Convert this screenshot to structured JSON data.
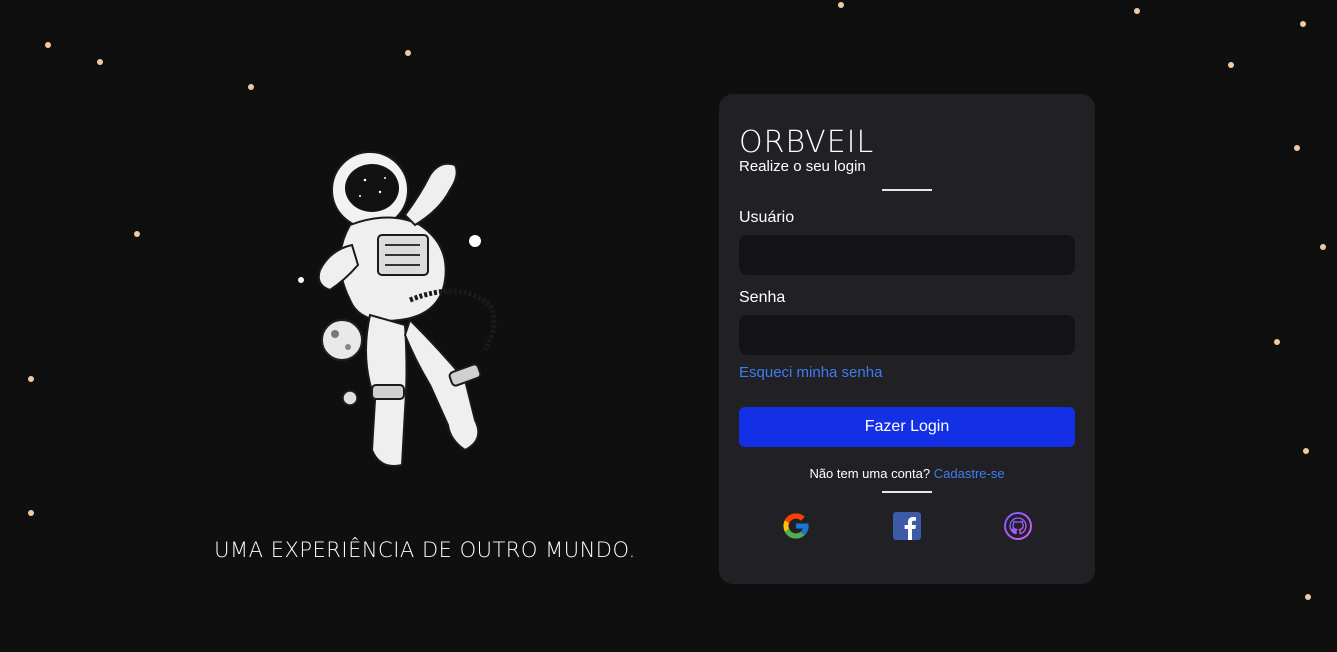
{
  "brand": {
    "logo_text": "ORBVEIL"
  },
  "hero": {
    "tagline": "UMA EXPERIÊNCIA DE OUTRO MUNDO.",
    "image": "astronaut-illustration"
  },
  "login_card": {
    "subtitle": "Realize o seu login",
    "username_label": "Usuário",
    "username_value": "",
    "password_label": "Senha",
    "password_value": "",
    "forgot_link": "Esqueci minha senha",
    "submit_label": "Fazer Login",
    "signup_prompt": "Não tem uma conta?",
    "signup_link": "Cadastre-se",
    "social": [
      {
        "name": "google",
        "icon": "google-icon"
      },
      {
        "name": "facebook",
        "icon": "facebook-icon"
      },
      {
        "name": "github",
        "icon": "github-icon"
      }
    ]
  },
  "colors": {
    "background": "#0f0f10",
    "card": "#212125",
    "input": "#131315",
    "primary_button": "#1430e6",
    "link": "#3f7cf0",
    "star": "#f2c9a1"
  }
}
